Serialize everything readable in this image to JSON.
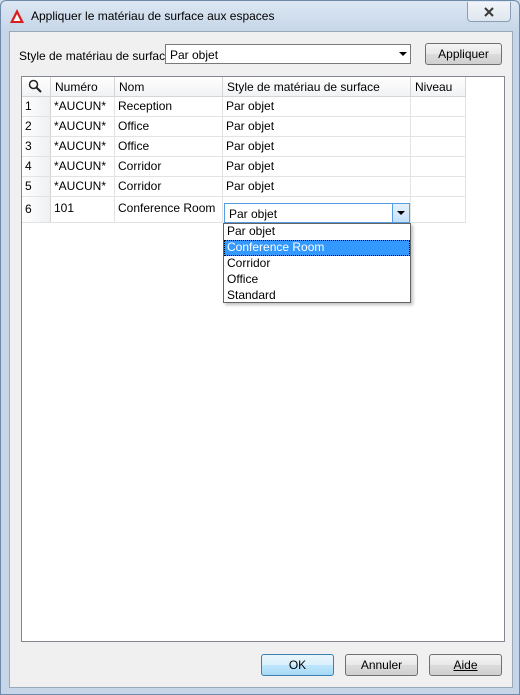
{
  "window": {
    "title": "Appliquer le matériau de surface aux espaces"
  },
  "style_row": {
    "label": "Style de matériau de surface:",
    "value": "Par objet",
    "apply_label": "Appliquer"
  },
  "grid": {
    "columns": [
      "Numéro",
      "Nom",
      "Style de matériau de surface",
      "Niveau"
    ],
    "rows": [
      {
        "index": "1",
        "number": "*AUCUN*",
        "name": "Reception",
        "style": "Par objet",
        "level": ""
      },
      {
        "index": "2",
        "number": "*AUCUN*",
        "name": "Office",
        "style": "Par objet",
        "level": ""
      },
      {
        "index": "3",
        "number": "*AUCUN*",
        "name": "Office",
        "style": "Par objet",
        "level": ""
      },
      {
        "index": "4",
        "number": "*AUCUN*",
        "name": "Corridor",
        "style": "Par objet",
        "level": ""
      },
      {
        "index": "5",
        "number": "*AUCUN*",
        "name": "Corridor",
        "style": "Par objet",
        "level": ""
      },
      {
        "index": "6",
        "number": "101",
        "name": "Conference Room",
        "style": "Par objet",
        "level": ""
      }
    ]
  },
  "dropdown": {
    "options": [
      "Par objet",
      "Conference Room",
      "Corridor",
      "Office",
      "Standard"
    ],
    "selected": "Conference Room"
  },
  "buttons": {
    "ok": "OK",
    "cancel": "Annuler",
    "help": "Aide"
  },
  "colors": {
    "selection": "#3399ff",
    "app_icon": "#d81e1e"
  }
}
